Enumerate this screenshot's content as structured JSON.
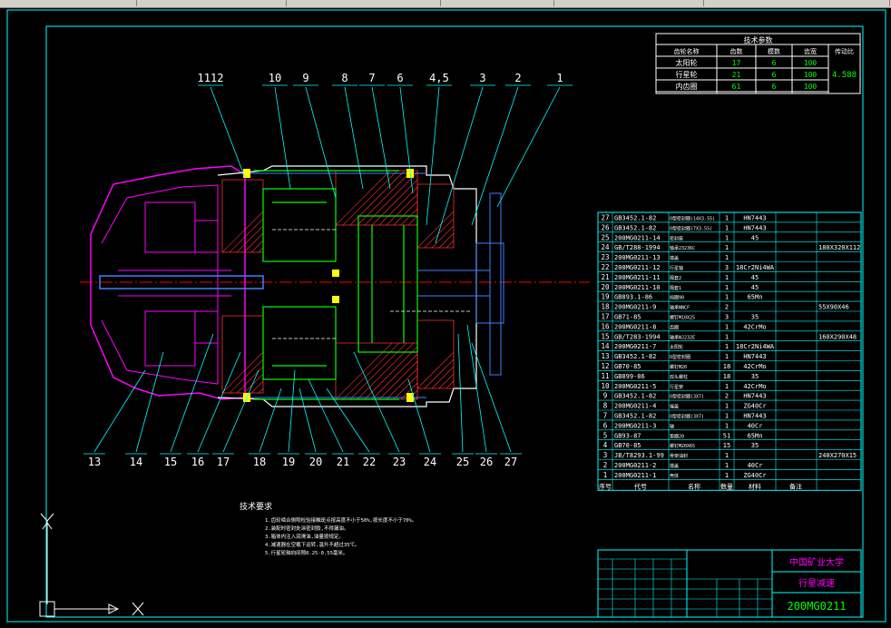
{
  "balloons": [
    "1112",
    "10",
    "9",
    "8",
    "7",
    "6",
    "4,5",
    "3",
    "2",
    "1"
  ],
  "balloons_bottom": [
    "13",
    "14",
    "15",
    "16",
    "17",
    "18",
    "19",
    "20",
    "21",
    "22",
    "23",
    "24",
    "25",
    "26",
    "27"
  ],
  "tech_table": {
    "title": "技术参数",
    "headers": [
      "齿轮名称",
      "齿数",
      "模数",
      "齿宽",
      "传动比"
    ],
    "rows": [
      [
        "太阳轮",
        "17",
        "6",
        "100"
      ],
      [
        "行星轮",
        "21",
        "6",
        "100"
      ],
      [
        "内齿圈",
        "61",
        "6",
        "100"
      ]
    ],
    "ratio": "4.588"
  },
  "bom": [
    [
      "27",
      "GB3452.1-82",
      "O型密封圈(14X3.55)",
      "1",
      "HN7443",
      ""
    ],
    [
      "26",
      "GB3452.1-82",
      "O型密封圈(7X3.55)",
      "1",
      "HN7443",
      ""
    ],
    [
      "25",
      "200MG0211-14",
      "密封座",
      "1",
      "45",
      ""
    ],
    [
      "24",
      "GB/T288-1994",
      "轴承23236C",
      "1",
      "",
      "180X320X112"
    ],
    [
      "23",
      "200MG0211-13",
      "端盖",
      "1",
      "",
      ""
    ],
    [
      "22",
      "200MG0211-12",
      "行星轴",
      "3",
      "18Cr2Ni4WA",
      ""
    ],
    [
      "21",
      "200MG0211-11",
      "隔套2",
      "1",
      "45",
      ""
    ],
    [
      "20",
      "200MG0211-10",
      "隔套1",
      "1",
      "45",
      ""
    ],
    [
      "19",
      "GB893.1-86",
      "挡圈90",
      "1",
      "65Mn",
      ""
    ],
    [
      "18",
      "200MG0211-9",
      "轴承NNCF",
      "2",
      "",
      "55X90X46"
    ],
    [
      "17",
      "GB71-85",
      "螺钉M10X25",
      "3",
      "35",
      ""
    ],
    [
      "16",
      "200MG0211-8",
      "齿圈",
      "1",
      "42CrMo",
      ""
    ],
    [
      "15",
      "GB/T283-1994",
      "轴承NJ232E",
      "1",
      "",
      "160X290X48"
    ],
    [
      "14",
      "200MG0211-7",
      "太阳轮",
      "1",
      "18Cr2Ni4WA",
      ""
    ],
    [
      "13",
      "GB3452.1-82",
      "O型密封圈",
      "1",
      "HN7443",
      ""
    ],
    [
      "12",
      "GB70-85",
      "螺钉M20",
      "18",
      "42CrMo",
      ""
    ],
    [
      "11",
      "GB899-86",
      "双头螺柱",
      "18",
      "35",
      ""
    ],
    [
      "10",
      "200MG0211-5",
      "行星架",
      "1",
      "42CrMo",
      ""
    ],
    [
      "9",
      "GB3452.1-82",
      "O型密封圈(3X7)",
      "2",
      "HN7443",
      ""
    ],
    [
      "8",
      "200MG0211-4",
      "端盖",
      "1",
      "ZG40Cr",
      ""
    ],
    [
      "7",
      "GB3452.1-82",
      "O型密封圈(3X7)",
      "1",
      "HN7443",
      ""
    ],
    [
      "6",
      "200MG0211-3",
      "轴",
      "1",
      "40Cr",
      ""
    ],
    [
      "5",
      "GB93-87",
      "垫圈20",
      "51",
      "65Mn",
      ""
    ],
    [
      "4",
      "GB70-85",
      "螺钉M20X65",
      "15",
      "35",
      ""
    ],
    [
      "3",
      "JB/T8293.1-99",
      "骨架油封",
      "1",
      "",
      "240X270X15"
    ],
    [
      "2",
      "200MG0211-2",
      "端盖",
      "1",
      "40Cr",
      ""
    ],
    [
      "1",
      "200MG0211-1",
      "壳体",
      "1",
      "ZG40Cr",
      ""
    ]
  ],
  "bom_header": [
    "序号",
    "代号",
    "名称",
    "数量",
    "材料",
    "备注"
  ],
  "title_block": {
    "school": "中国矿业大学",
    "drawing_name": "行星减速",
    "drawing_no": "200MG0211"
  },
  "notes": {
    "heading": "技术要求",
    "lines": [
      "1.齿轮啮合侧隙检验接触斑点按高度不小于50%,按长度不小于70%。",
      "2.装配时密封处涂密封胶,不得漏油。",
      "3.箱体内注入润滑油,油量按规定。",
      "4.减速器在空载下运转,温升不超过35℃。",
      "5.行星轮轴向间隙0.25-0.55毫米。"
    ]
  },
  "colors": {
    "frame": "#00ffff",
    "green": "#00ff00",
    "magenta": "#ff00ff",
    "yellow": "#ffff00",
    "white": "#ffffff",
    "blue": "#0000ff",
    "red": "#ff0000"
  }
}
